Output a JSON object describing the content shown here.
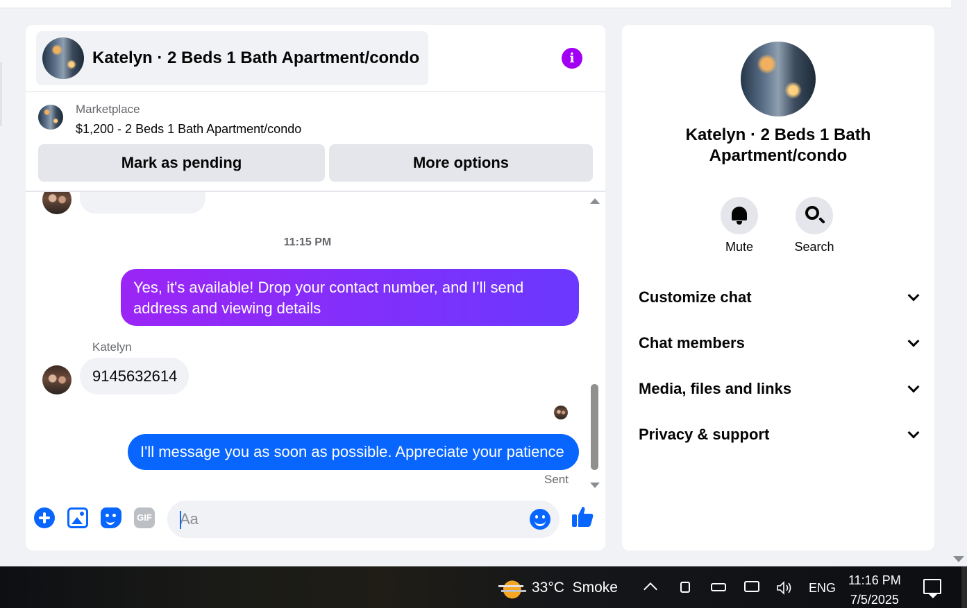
{
  "chat": {
    "title": "Katelyn · 2 Beds 1 Bath Apartment/condo",
    "marketplace_label": "Marketplace",
    "listing": "$1,200 - 2 Beds 1 Bath Apartment/condo",
    "mark_pending_label": "Mark as pending",
    "more_options_label": "More options",
    "timestamp": "11:15 PM",
    "messages": [
      {
        "from": "me",
        "text": "Yes, it's available! Drop your contact number, and I’ll send address and viewing details"
      },
      {
        "from": "Katelyn",
        "sender": "Katelyn",
        "text": "9145632614"
      },
      {
        "from": "me",
        "text": "I'll message you as soon as possible. Appreciate your patience"
      }
    ],
    "status": "Sent",
    "composer_placeholder": "Aa",
    "gif_label": "GIF",
    "accent_color": "#0866ff",
    "gradient_color": "#9b25f5"
  },
  "info_panel": {
    "title": "Katelyn · 2 Beds 1 Bath Apartment/condo",
    "mute_label": "Mute",
    "search_label": "Search",
    "sections": [
      "Customize chat",
      "Chat members",
      "Media, files and links",
      "Privacy & support"
    ]
  },
  "taskbar": {
    "weather_temp": "33°C",
    "weather_condition": "Smoke",
    "language": "ENG",
    "time": "11:16 PM",
    "date": "7/5/2025"
  }
}
